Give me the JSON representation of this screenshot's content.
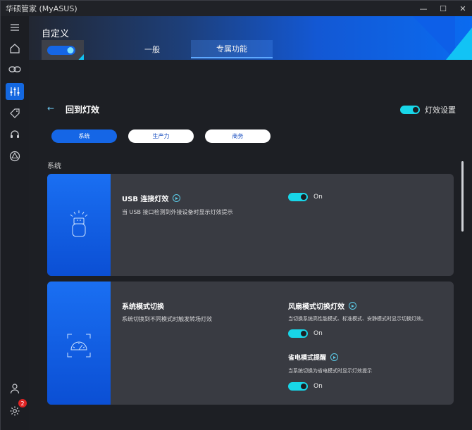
{
  "window": {
    "title": "华硕管家 (MyASUS)",
    "controls": [
      "—",
      "☐",
      "✕"
    ]
  },
  "sidebar": {
    "items": [
      {
        "icon": "menu-icon"
      },
      {
        "icon": "home-icon"
      },
      {
        "icon": "link-icon"
      },
      {
        "icon": "sliders-icon",
        "active": true
      },
      {
        "icon": "tag-icon"
      },
      {
        "icon": "headset-icon"
      },
      {
        "icon": "triangle-icon"
      }
    ],
    "user_icon": "user-icon",
    "settings_icon": "gear-icon",
    "settings_badge": "2"
  },
  "header": {
    "title": "自定义",
    "tabs": [
      {
        "label": "一般"
      },
      {
        "label": "专属功能",
        "active": true
      }
    ]
  },
  "section": {
    "back_icon": "←",
    "title": "回到灯效",
    "light_settings_label": "灯效设置",
    "light_settings_on": true
  },
  "chips": [
    {
      "label": "系统",
      "active": true
    },
    {
      "label": "生产力",
      "active": false
    },
    {
      "label": "商务",
      "active": false
    }
  ],
  "group_label": "系统",
  "cards": [
    {
      "title": "USB 连接灯效",
      "desc": "当 USB 接口检测到外接设备时显示灯效提示",
      "toggle_label": "On",
      "icon": "usb-icon"
    },
    {
      "title": "系统模式切换",
      "desc": "系统切换到不同模式时触发转场灯效",
      "icon": "speedometer-icon",
      "sub": [
        {
          "title": "风扇模式切换灯效",
          "desc": "当切换系统高性能模式、标准模式、安静模式时显示切换灯效。",
          "toggle_label": "On"
        },
        {
          "title": "省电模式提醒",
          "desc": "当系统切换为省电模式时显示灯效提示",
          "toggle_label": "On"
        }
      ]
    }
  ],
  "colors": {
    "accent": "#1566e6",
    "toggle": "#18d6e8",
    "card": "#393b42"
  }
}
